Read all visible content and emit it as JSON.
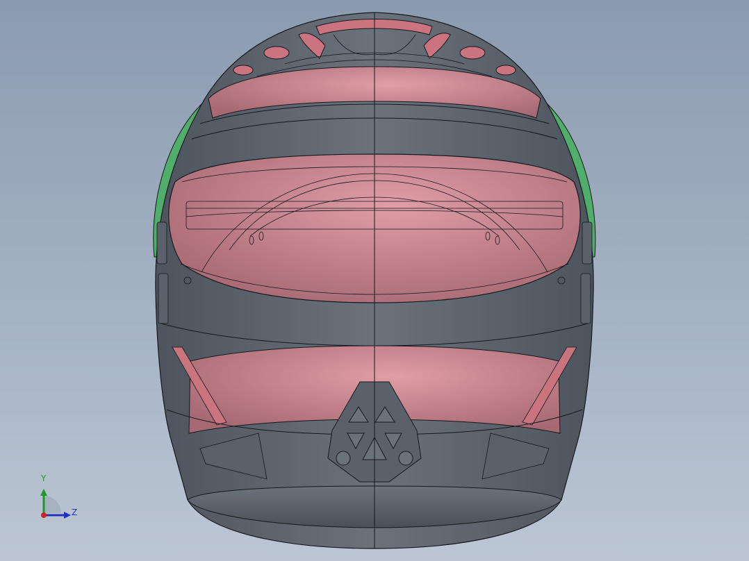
{
  "viewport": {
    "background_top": "#8b9bb0",
    "background_bottom": "#bcc6d4"
  },
  "model": {
    "name": "helmet",
    "shell_color": "#5e6670",
    "highlight_color": "#d98a94",
    "trim_color": "#4fae6a",
    "edge_color": "#15181c"
  },
  "triad": {
    "y_label": "Y",
    "z_label": "Z",
    "y_color": "#1a9a2a",
    "z_color": "#2233bb",
    "x_color": "#cc2222"
  }
}
